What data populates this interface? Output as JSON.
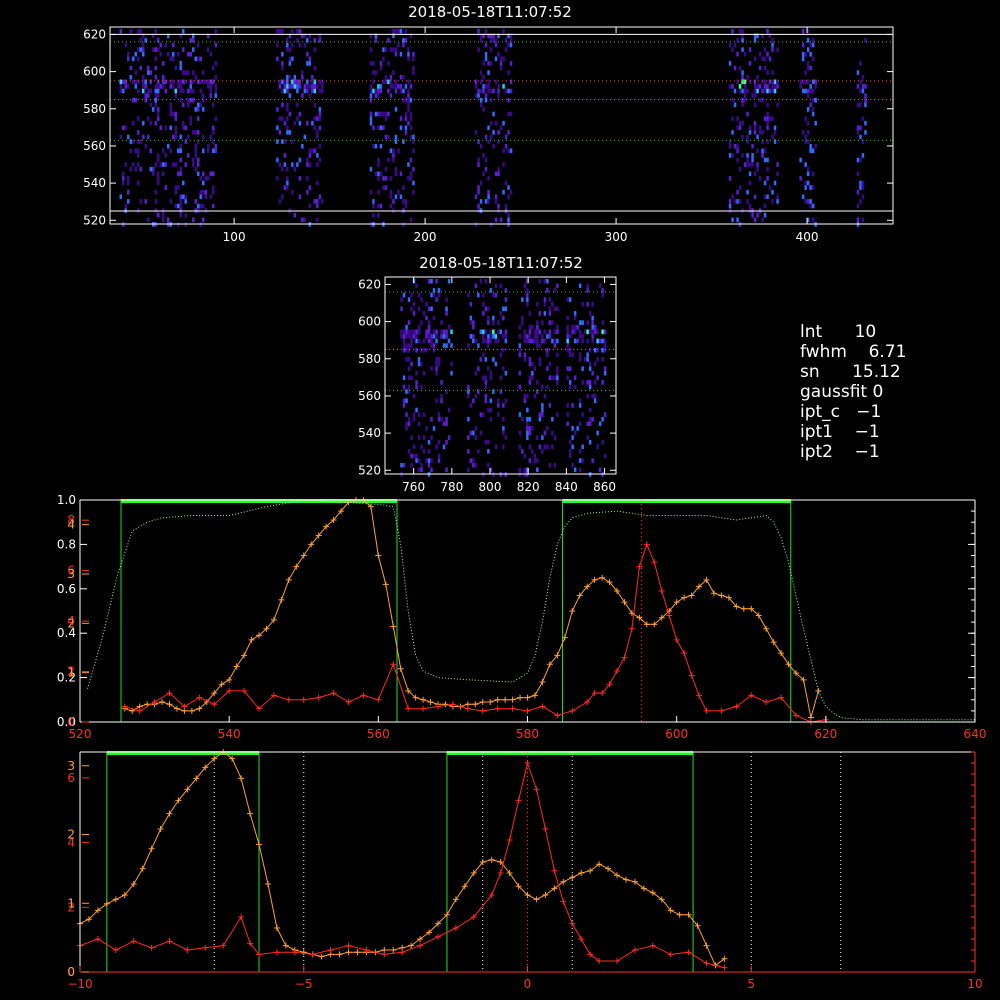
{
  "chart_data": [
    {
      "type": "heatmap",
      "title": "2018-05-18T11:07:52",
      "x_ticks": [
        100,
        200,
        300,
        400
      ],
      "y_ticks": [
        520,
        540,
        560,
        580,
        600,
        620
      ],
      "xlim": [
        35,
        445
      ],
      "ylim": [
        518,
        624
      ],
      "bright_bands_x": [
        [
          40,
          90
        ],
        [
          122,
          146
        ],
        [
          171,
          194
        ],
        [
          226,
          245
        ],
        [
          359,
          384
        ],
        [
          396,
          405
        ],
        [
          426,
          430
        ]
      ],
      "ref_lines_y": [
        525,
        563,
        585,
        595,
        616,
        620
      ],
      "colormap": [
        "#3a0a8a",
        "#5a1fd0",
        "#2f6cff",
        "#2ad0ff",
        "#3cff8a"
      ]
    },
    {
      "type": "heatmap",
      "title": "2018-05-18T11:07:52",
      "x_ticks": [
        760,
        780,
        800,
        820,
        840,
        860
      ],
      "y_ticks": [
        520,
        540,
        560,
        580,
        600,
        620
      ],
      "xlim": [
        745,
        866
      ],
      "ylim": [
        518,
        624
      ],
      "bright_bands_x": [
        [
          753,
          780
        ],
        [
          788,
          808
        ],
        [
          815,
          835
        ],
        [
          840,
          860
        ]
      ],
      "ref_lines_y": [
        563,
        585,
        616
      ]
    },
    {
      "type": "line",
      "xlim": [
        520,
        640
      ],
      "x_ticks": [
        520,
        540,
        560,
        580,
        600,
        620,
        640
      ],
      "left_axis": {
        "ticks": [
          "0.0",
          "0.2",
          "0.4",
          "0.6",
          "0.8",
          "1.0"
        ],
        "range": [
          0,
          1
        ]
      },
      "red_axis_labels": [
        "0",
        "2",
        "4",
        "6",
        "8"
      ],
      "orange_axis_labels": [
        "1",
        "2",
        "3",
        "4"
      ],
      "filter_bands": [
        [
          525.5,
          562.5
        ],
        [
          584.7,
          615.3
        ]
      ],
      "marker_x": 595.3,
      "series": [
        {
          "color": "#ffa033",
          "x": [
            526,
            527,
            528,
            529,
            530,
            531,
            532,
            533,
            534,
            535,
            536,
            537,
            538,
            539,
            540,
            541,
            542,
            543,
            544,
            545,
            546,
            547,
            548,
            549,
            550,
            551,
            552,
            553,
            554,
            555,
            556,
            557,
            558,
            559,
            560,
            561,
            562,
            563,
            564,
            565,
            566,
            567,
            568,
            569,
            570,
            571,
            572,
            573,
            574,
            575,
            576,
            577,
            578,
            579,
            580,
            581,
            582,
            583,
            584,
            585,
            586,
            587,
            588,
            589,
            590,
            591,
            592,
            593,
            594,
            595,
            596,
            597,
            598,
            599,
            600,
            601,
            602,
            603,
            604,
            605,
            606,
            607,
            608,
            609,
            610,
            611,
            612,
            613,
            614,
            615,
            616,
            617,
            618,
            619
          ],
          "y": [
            0.06,
            0.05,
            0.07,
            0.08,
            0.08,
            0.09,
            0.08,
            0.06,
            0.05,
            0.05,
            0.06,
            0.09,
            0.13,
            0.17,
            0.19,
            0.25,
            0.3,
            0.37,
            0.39,
            0.42,
            0.46,
            0.55,
            0.64,
            0.7,
            0.75,
            0.8,
            0.84,
            0.88,
            0.91,
            0.95,
            0.99,
            1.0,
            1.0,
            0.97,
            0.75,
            0.62,
            0.43,
            0.24,
            0.14,
            0.11,
            0.1,
            0.09,
            0.08,
            0.08,
            0.07,
            0.07,
            0.08,
            0.08,
            0.09,
            0.09,
            0.1,
            0.1,
            0.1,
            0.11,
            0.11,
            0.12,
            0.18,
            0.26,
            0.3,
            0.38,
            0.5,
            0.57,
            0.61,
            0.64,
            0.65,
            0.63,
            0.59,
            0.54,
            0.49,
            0.47,
            0.44,
            0.44,
            0.47,
            0.5,
            0.54,
            0.56,
            0.57,
            0.61,
            0.64,
            0.58,
            0.57,
            0.56,
            0.52,
            0.51,
            0.51,
            0.48,
            0.42,
            0.36,
            0.31,
            0.26,
            0.22,
            0.19,
            0.02,
            0.14
          ]
        },
        {
          "color": "#ff2a1f",
          "x": [
            526,
            528,
            530,
            532,
            534,
            536,
            538,
            540,
            542,
            544,
            546,
            548,
            550,
            552,
            554,
            556,
            558,
            560,
            562,
            564,
            566,
            568,
            570,
            572,
            574,
            576,
            578,
            580,
            582,
            584,
            586,
            588,
            589,
            590,
            591,
            592,
            593,
            594,
            595,
            596,
            597,
            598,
            599,
            600,
            601,
            602,
            603,
            604,
            606,
            608,
            610,
            612,
            614,
            616,
            618,
            620
          ],
          "y": [
            0.07,
            0.05,
            0.09,
            0.13,
            0.07,
            0.11,
            0.08,
            0.14,
            0.14,
            0.06,
            0.12,
            0.1,
            0.1,
            0.11,
            0.13,
            0.09,
            0.12,
            0.1,
            0.26,
            0.06,
            0.06,
            0.07,
            0.08,
            0.06,
            0.05,
            0.06,
            0.06,
            0.05,
            0.07,
            0.03,
            0.05,
            0.09,
            0.13,
            0.13,
            0.17,
            0.23,
            0.29,
            0.42,
            0.7,
            0.8,
            0.72,
            0.59,
            0.48,
            0.37,
            0.31,
            0.21,
            0.12,
            0.05,
            0.05,
            0.07,
            0.12,
            0.09,
            0.11,
            0.03,
            0.0,
            0.01
          ]
        },
        {
          "color": "#9cff9c",
          "dotted": true,
          "x": [
            521,
            523,
            525,
            527,
            529,
            531,
            535,
            540,
            545,
            550,
            555,
            560,
            562,
            563,
            564,
            565,
            566,
            568,
            572,
            578,
            580,
            581,
            582,
            583,
            584,
            585,
            586,
            588,
            592,
            596,
            600,
            604,
            608,
            612,
            613,
            614,
            615,
            616,
            617,
            618,
            619,
            620,
            621,
            622,
            625,
            630,
            635,
            640
          ],
          "y": [
            0.15,
            0.38,
            0.66,
            0.86,
            0.9,
            0.92,
            0.93,
            0.93,
            0.97,
            1.0,
            0.99,
            0.98,
            0.97,
            0.8,
            0.5,
            0.3,
            0.23,
            0.2,
            0.19,
            0.18,
            0.22,
            0.3,
            0.45,
            0.65,
            0.8,
            0.88,
            0.92,
            0.94,
            0.95,
            0.93,
            0.93,
            0.93,
            0.91,
            0.93,
            0.9,
            0.83,
            0.72,
            0.57,
            0.42,
            0.28,
            0.14,
            0.07,
            0.04,
            0.02,
            0.01,
            0.01,
            0.01,
            0.01
          ]
        }
      ]
    },
    {
      "type": "line",
      "xlim": [
        -10,
        10
      ],
      "x_ticks": [
        "-10",
        "-5",
        "0",
        "5",
        "10"
      ],
      "red_axis_labels": [
        "0",
        "2",
        "4",
        "6"
      ],
      "orange_axis_labels": [
        "0",
        "1",
        "2",
        "3"
      ],
      "filter_bands": [
        [
          -9.4,
          -6
        ],
        [
          -1.8,
          3.7
        ]
      ],
      "dotted_x": [
        -7,
        -5,
        -1,
        0,
        1,
        5,
        7
      ],
      "series": [
        {
          "color": "#ffa033",
          "x": [
            -10,
            -9.8,
            -9.6,
            -9.4,
            -9.2,
            -9,
            -8.8,
            -8.6,
            -8.4,
            -8.2,
            -8,
            -7.8,
            -7.6,
            -7.4,
            -7.2,
            -7,
            -6.8,
            -6.6,
            -6.4,
            -6.2,
            -6,
            -5.8,
            -5.6,
            -5.4,
            -5.2,
            -5,
            -4.8,
            -4.6,
            -4.4,
            -4.2,
            -4,
            -3.8,
            -3.6,
            -3.4,
            -3.2,
            -3,
            -2.8,
            -2.6,
            -2.4,
            -2.2,
            -2,
            -1.8,
            -1.6,
            -1.4,
            -1.2,
            -1,
            -0.8,
            -0.6,
            -0.4,
            -0.2,
            0,
            0.2,
            0.4,
            0.6,
            0.8,
            1,
            1.2,
            1.4,
            1.6,
            1.8,
            2,
            2.2,
            2.4,
            2.6,
            2.8,
            3,
            3.2,
            3.4,
            3.6,
            3.8,
            4,
            4.2,
            4.4
          ],
          "y": [
            0.22,
            0.24,
            0.28,
            0.31,
            0.33,
            0.35,
            0.4,
            0.47,
            0.56,
            0.65,
            0.72,
            0.78,
            0.83,
            0.88,
            0.93,
            0.97,
            1.0,
            0.97,
            0.88,
            0.72,
            0.58,
            0.4,
            0.2,
            0.12,
            0.1,
            0.09,
            0.08,
            0.07,
            0.08,
            0.08,
            0.09,
            0.09,
            0.09,
            0.09,
            0.1,
            0.1,
            0.11,
            0.12,
            0.15,
            0.18,
            0.22,
            0.26,
            0.33,
            0.39,
            0.45,
            0.5,
            0.51,
            0.5,
            0.45,
            0.39,
            0.35,
            0.33,
            0.35,
            0.38,
            0.41,
            0.43,
            0.45,
            0.46,
            0.49,
            0.47,
            0.44,
            0.42,
            0.41,
            0.38,
            0.36,
            0.33,
            0.28,
            0.26,
            0.26,
            0.21,
            0.12,
            0.03,
            0.06
          ]
        },
        {
          "color": "#ff2a1f",
          "x": [
            -10,
            -9.6,
            -9.2,
            -8.8,
            -8.4,
            -8,
            -7.6,
            -7.2,
            -6.8,
            -6.4,
            -6.2,
            -6,
            -5.6,
            -5.2,
            -4.8,
            -4.4,
            -4,
            -3.6,
            -3.2,
            -2.8,
            -2.4,
            -2,
            -1.6,
            -1.2,
            -0.8,
            -0.6,
            -0.4,
            -0.2,
            0,
            0.2,
            0.4,
            0.6,
            0.8,
            1,
            1.2,
            1.4,
            1.6,
            2,
            2.4,
            2.8,
            3.2,
            3.6,
            4,
            4.4
          ],
          "y": [
            0.12,
            0.15,
            0.1,
            0.14,
            0.11,
            0.14,
            0.1,
            0.11,
            0.12,
            0.25,
            0.13,
            0.08,
            0.09,
            0.09,
            0.08,
            0.1,
            0.12,
            0.1,
            0.08,
            0.09,
            0.12,
            0.16,
            0.2,
            0.25,
            0.35,
            0.45,
            0.6,
            0.78,
            0.95,
            0.83,
            0.65,
            0.46,
            0.32,
            0.22,
            0.15,
            0.08,
            0.05,
            0.05,
            0.1,
            0.12,
            0.08,
            0.09,
            0.04,
            0.02
          ]
        }
      ]
    }
  ],
  "info": [
    {
      "label": "lnt",
      "value": "10"
    },
    {
      "label": "fwhm",
      "value": "6.71"
    },
    {
      "label": "sn",
      "value": "15.12"
    },
    {
      "label": "gaussfit",
      "value": "0"
    },
    {
      "label": "ipt_c",
      "value": "−1"
    },
    {
      "label": "ipt1",
      "value": "−1"
    },
    {
      "label": "ipt2",
      "value": "−1"
    }
  ]
}
